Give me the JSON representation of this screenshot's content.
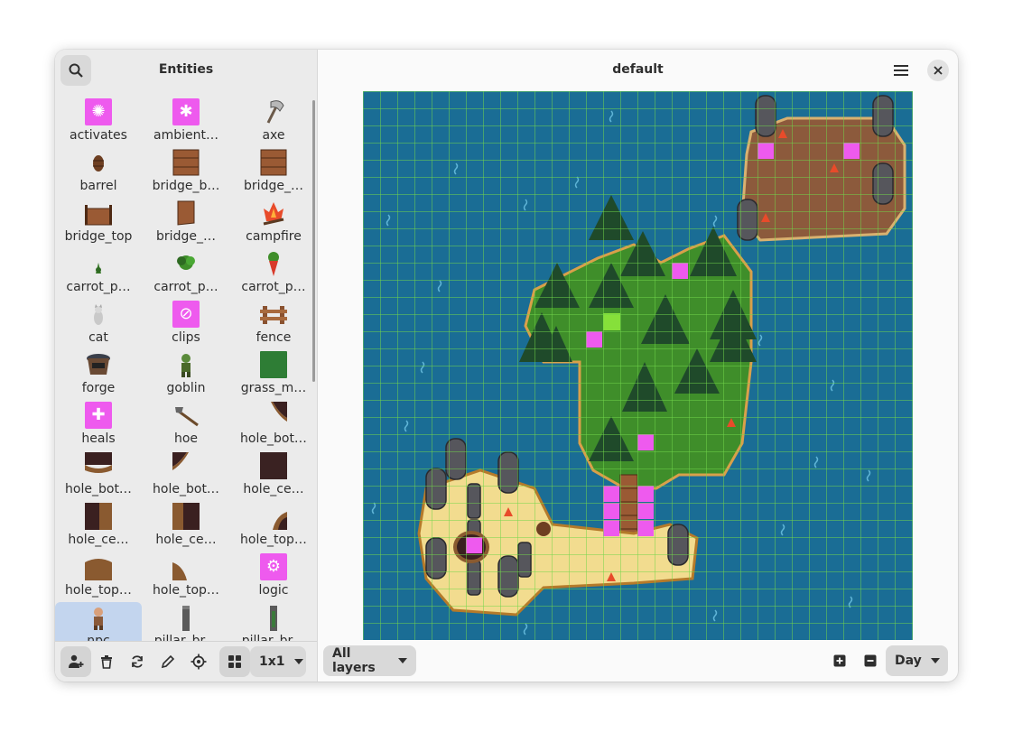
{
  "sidebar": {
    "title": "Entities",
    "entities": [
      {
        "label": "activates",
        "icon": "activates-icon"
      },
      {
        "label": "ambient…",
        "icon": "ambient-icon"
      },
      {
        "label": "axe",
        "icon": "axe-icon"
      },
      {
        "label": "barrel",
        "icon": "barrel-icon"
      },
      {
        "label": "bridge_b…",
        "icon": "bridge-bottom-icon"
      },
      {
        "label": "bridge_…",
        "icon": "bridge-icon"
      },
      {
        "label": "bridge_top",
        "icon": "bridge-top-icon"
      },
      {
        "label": "bridge_…",
        "icon": "bridge-side-icon"
      },
      {
        "label": "campfire",
        "icon": "campfire-icon"
      },
      {
        "label": "carrot_p…",
        "icon": "carrot-sprout-icon"
      },
      {
        "label": "carrot_p…",
        "icon": "carrot-plant-icon"
      },
      {
        "label": "carrot_p…",
        "icon": "carrot-ripe-icon"
      },
      {
        "label": "cat",
        "icon": "cat-icon"
      },
      {
        "label": "clips",
        "icon": "clips-icon"
      },
      {
        "label": "fence",
        "icon": "fence-icon"
      },
      {
        "label": "forge",
        "icon": "forge-icon"
      },
      {
        "label": "goblin",
        "icon": "goblin-icon"
      },
      {
        "label": "grass_m…",
        "icon": "grass-icon"
      },
      {
        "label": "heals",
        "icon": "heals-icon"
      },
      {
        "label": "hoe",
        "icon": "hoe-icon"
      },
      {
        "label": "hole_bot…",
        "icon": "hole-bottom-icon"
      },
      {
        "label": "hole_bot…",
        "icon": "hole-bottom-icon"
      },
      {
        "label": "hole_bot…",
        "icon": "hole-bottom-icon"
      },
      {
        "label": "hole_ce…",
        "icon": "hole-center-icon"
      },
      {
        "label": "hole_ce…",
        "icon": "hole-center-icon"
      },
      {
        "label": "hole_ce…",
        "icon": "hole-center-icon"
      },
      {
        "label": "hole_top…",
        "icon": "hole-top-icon"
      },
      {
        "label": "hole_top…",
        "icon": "hole-top-icon"
      },
      {
        "label": "hole_top…",
        "icon": "hole-top-icon"
      },
      {
        "label": "logic",
        "icon": "logic-icon"
      },
      {
        "label": "npc",
        "icon": "npc-icon"
      },
      {
        "label": "pillar_br…",
        "icon": "pillar-icon"
      },
      {
        "label": "pillar_br…",
        "icon": "pillar-icon"
      }
    ],
    "selected_index": 30,
    "size_option": "1x1"
  },
  "main": {
    "title": "default",
    "layers_option": "All layers",
    "time_option": "Day"
  },
  "colors": {
    "accent_magenta": "#ee5aee",
    "water": "#1a6d95",
    "grid_line": "#72d64a",
    "grass": "#3f8e2a",
    "sand": "#f2dc8f",
    "dirt": "#8c5a3c",
    "selection": "#c3d5ee"
  }
}
